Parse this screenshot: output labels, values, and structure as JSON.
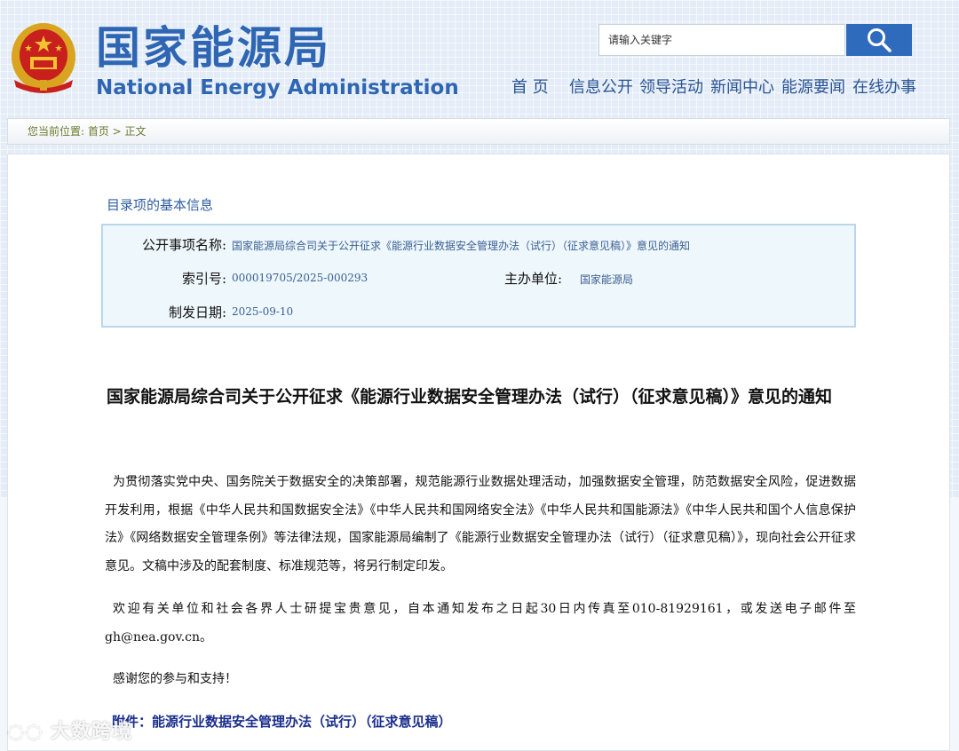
{
  "header": {
    "logo_cn": "国家能源局",
    "logo_en": "National Energy Administration",
    "search_placeholder": "请输入关键字",
    "nav": [
      "首 页",
      "信息公开",
      "领导活动",
      "新闻中心",
      "能源要闻",
      "在线办事"
    ]
  },
  "breadcrumb": {
    "text": "您当前位置: 首页 > 正文"
  },
  "meta": {
    "section_title": "目录项的基本信息",
    "name_label": "公开事项名称:",
    "name_value": "国家能源局综合司关于公开征求《能源行业数据安全管理办法（试行）（征求意见稿）》意见的通知",
    "index_label": "索引号:",
    "index_value": "000019705/2025-000293",
    "org_label": "主办单位:",
    "org_value": "国家能源局",
    "date_label": "制发日期:",
    "date_value": "2025-09-10"
  },
  "article": {
    "title": "国家能源局综合司关于公开征求《能源行业数据安全管理办法（试行）（征求意见稿）》意见的通知",
    "para1": "为贯彻落实党中央、国务院关于数据安全的决策部署，规范能源行业数据处理活动，加强数据安全管理，防范数据安全风险，促进数据开发利用，根据《中华人民共和国数据安全法》《中华人民共和国网络安全法》《中华人民共和国能源法》《中华人民共和国个人信息保护法》《网络数据安全管理条例》等法律法规，国家能源局编制了《能源行业数据安全管理办法（试行）（征求意见稿）》，现向社会公开征求意见。文稿中涉及的配套制度、标准规范等，将另行制定印发。",
    "para2": "欢迎有关单位和社会各界人士研提宝贵意见，自本通知发布之日起30日内传真至010-81929161，或发送电子邮件至gh@nea.gov.cn。",
    "para3": "感谢您的参与和支持！",
    "attachment": "附件：能源行业数据安全管理办法（试行）（征求意见稿）"
  },
  "watermark": "大数跨境",
  "colors": {
    "brand_blue": "#2f66b3",
    "search_button": "#2f6bbd",
    "meta_box_bg": "#eef7fb",
    "attachment_link": "#1a2e8c"
  }
}
